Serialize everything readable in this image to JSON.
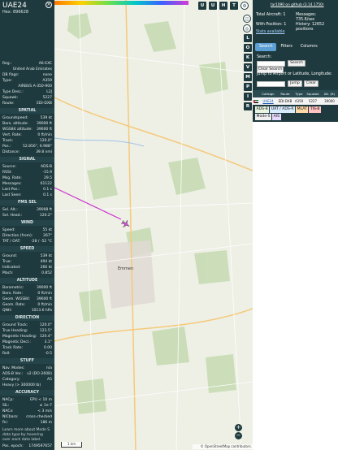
{
  "aircraft": {
    "callsign": "UAE24",
    "hex_label": "Hex:",
    "hex_value": "896628"
  },
  "details": [
    {
      "k": "Reg.:",
      "v": "A6-EXC"
    },
    {
      "k": "",
      "v": "United Arab Emirates"
    },
    {
      "k": "DB flags:",
      "v": "none"
    },
    {
      "k": "Type:",
      "v": "A359"
    },
    {
      "k": "",
      "v": "AIRBUS A-350-900"
    },
    {
      "k": "Type Desc.:",
      "v": "L2J"
    },
    {
      "k": "Squawk:",
      "v": "5227"
    },
    {
      "k": "Route:",
      "v": "EDI-DXB"
    }
  ],
  "sections": {
    "spatial": {
      "title": "SPATIAL",
      "rows": [
        {
          "k": "Groundspeed:",
          "v": "539 kt"
        },
        {
          "k": "Baro. altitude:",
          "v": "39000 ft"
        },
        {
          "k": "WGS84 altitude:",
          "v": "39600 ft"
        },
        {
          "k": "Vert. Rate:",
          "v": "0 ft/min"
        },
        {
          "k": "Track:",
          "v": "120.0°"
        },
        {
          "k": "Pos.:",
          "v": "52.856°, 6.988°"
        },
        {
          "k": "Distance:",
          "v": "39.8 nmi"
        }
      ]
    },
    "signal": {
      "title": "SIGNAL",
      "rows": [
        {
          "k": "Source:",
          "v": "ADS-B"
        },
        {
          "k": "RSSI:",
          "v": "-15.9"
        },
        {
          "k": "Msg. Rate:",
          "v": "29.5"
        },
        {
          "k": "Messages:",
          "v": "61122"
        },
        {
          "k": "Last Pos.:",
          "v": "0.1 s"
        },
        {
          "k": "Last Seen:",
          "v": "0.1 s"
        }
      ]
    },
    "fms": {
      "title": "FMS SEL",
      "rows": [
        {
          "k": "Sel. Alt.:",
          "v": "39008 ft"
        },
        {
          "k": "Sel. Head.:",
          "v": "120.2°"
        }
      ]
    },
    "wind": {
      "title": "WIND",
      "rows": [
        {
          "k": "Speed:",
          "v": "55 kt"
        },
        {
          "k": "Direction (from):",
          "v": "267°"
        },
        {
          "k": "TAT / OAT:",
          "v": "-28 / -52 °C"
        }
      ]
    },
    "speed": {
      "title": "SPEED",
      "rows": [
        {
          "k": "Ground:",
          "v": "539 kt"
        },
        {
          "k": "True:",
          "v": "494 kt"
        },
        {
          "k": "Indicated:",
          "v": "266 kt"
        },
        {
          "k": "Mach:",
          "v": "0.852"
        }
      ]
    },
    "altitude": {
      "title": "ALTITUDE",
      "rows": [
        {
          "k": "Barometric:",
          "v": "39000 ft"
        },
        {
          "k": "Baro. Rate:",
          "v": "0 ft/min"
        },
        {
          "k": "Geom. WGS84:",
          "v": "39600 ft"
        },
        {
          "k": "Geom. Rate:",
          "v": "0 ft/min"
        },
        {
          "k": "QNH:",
          "v": "1013.6 hPa"
        }
      ]
    },
    "direction": {
      "title": "DIRECTION",
      "rows": [
        {
          "k": "Ground Track:",
          "v": "120.0°"
        },
        {
          "k": "True Heading:",
          "v": "123.5°"
        },
        {
          "k": "Magnetic Heading:",
          "v": "120.4°"
        },
        {
          "k": "Magnetic Decl.:",
          "v": "3.1°"
        },
        {
          "k": "Track Rate:",
          "v": "0.00"
        },
        {
          "k": "Roll:",
          "v": "-0.5"
        }
      ]
    },
    "stuff": {
      "title": "STUFF",
      "rows": [
        {
          "k": "Nav. Modes:",
          "v": "n/a"
        },
        {
          "k": "ADS-B Ver.:",
          "v": "v2 (DO-260B)"
        },
        {
          "k": "Category:",
          "v": "A5"
        },
        {
          "k": "Heavy (> 300000 lb)",
          "v": ""
        }
      ]
    },
    "accuracy": {
      "title": "ACCURACY",
      "rows": [
        {
          "k": "NACp:",
          "v": "EPU < 10 m"
        },
        {
          "k": "SIL:",
          "v": "≤ 1e-7"
        },
        {
          "k": "NACv:",
          "v": "< 3 m/s"
        },
        {
          "k": "NICbaro:",
          "v": "cross-checked"
        },
        {
          "k": "Rc:",
          "v": "186 m"
        }
      ]
    }
  },
  "footer": {
    "learn_more": "Learn more about Mode S data type by hovering over each data label.",
    "position_label": "Pos. epoch:",
    "position_value": "1749597657"
  },
  "map": {
    "top_buttons": [
      "U",
      "U",
      "H",
      "T"
    ],
    "side_buttons": [
      "L",
      "O",
      "K",
      "V",
      "M",
      "P",
      "I",
      "R"
    ],
    "zoom_in": "+",
    "zoom_out": "−",
    "scale_label": "1 km",
    "attribution": "© OpenStreetMap contributors.",
    "place_label": "Emmen",
    "track_color": "#cc33cc",
    "aircraft_color": "#d64ad6"
  },
  "right_panel": {
    "version_link": "tar1090 on github (3.14.1750)",
    "total_aircraft": "Total Aircraft: 1",
    "with_position": "With Position: 1",
    "stats_available": "Stats available",
    "messages": "Messages: 735.6/sec",
    "history": "History: 12652 positions",
    "tabs": [
      "Search",
      "Filters",
      "Columns"
    ],
    "search_label": "Search:",
    "search_button": "Search",
    "clear_search_button": "Clear Search",
    "jump_label": "Jump to Airport or Latitude, Longitude:",
    "jump_button": "Jump",
    "clear_button": "Clear",
    "table_headers": [
      "",
      "Callsign",
      "Route",
      "Type",
      "Squawk",
      "Alt. (ft)"
    ],
    "table_row": [
      "",
      "UAE24",
      "EDI-DXB",
      "A359",
      "5227",
      "39000"
    ],
    "legend_row1": [
      "ADS-B",
      "UAT / ADS-R",
      "MLAT",
      "TIS-B"
    ],
    "legend_row2": [
      "Mode-S",
      "AIS"
    ],
    "accent": "#5c9fd4",
    "panel_color": "#1f3a3e"
  }
}
